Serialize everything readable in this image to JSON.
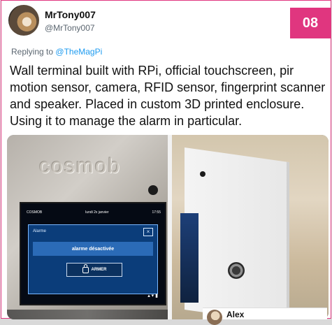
{
  "page_badge": "08",
  "author": {
    "name": "MrTony007",
    "handle": "@MrTony007"
  },
  "reply": {
    "prefix": "Replying to",
    "mention": "@TheMagPi"
  },
  "tweet_text": "Wall terminal built with RPi, official touchscreen, pir motion sensor, camera, RFID sensor, fingerprint scanner and speaker. Placed in custom 3D printed enclosure. Using it to manage the alarm in particular.",
  "photo_left": {
    "embossed_text": "cosmob",
    "screen": {
      "top_left": "COSMOB",
      "top_center": "lundi 2x janvier",
      "top_right": "17:55",
      "dialog_title": "Alarme",
      "close_label": "×",
      "state_text": "alarme désactivée",
      "arm_button_label": "ARMER",
      "status_icons": "▴ ▾ ▮"
    }
  },
  "peek_card": {
    "name": "Alex"
  },
  "colors": {
    "accent": "#e0367f",
    "link": "#1d9bf0"
  }
}
